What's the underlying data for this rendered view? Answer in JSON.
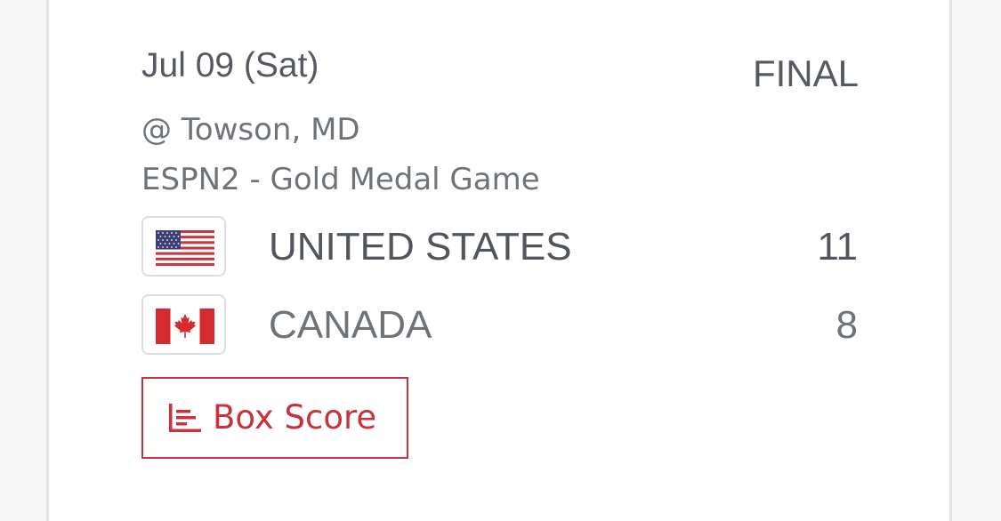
{
  "game": {
    "date": "Jul 09 (Sat)",
    "status": "FINAL",
    "location": "@ Towson, MD",
    "broadcast": "ESPN2 - Gold Medal Game"
  },
  "teams": [
    {
      "name": "UNITED STATES",
      "score": "11",
      "flag_icon": "us-flag-icon"
    },
    {
      "name": "CANADA",
      "score": "8",
      "flag_icon": "canada-flag-icon"
    }
  ],
  "actions": {
    "box_score_label": "Box Score",
    "box_score_icon": "bar-chart-icon"
  },
  "colors": {
    "accent": "#c8323f",
    "text_primary": "#50565c",
    "text_secondary": "#6e7378",
    "border": "#dcdde0"
  }
}
